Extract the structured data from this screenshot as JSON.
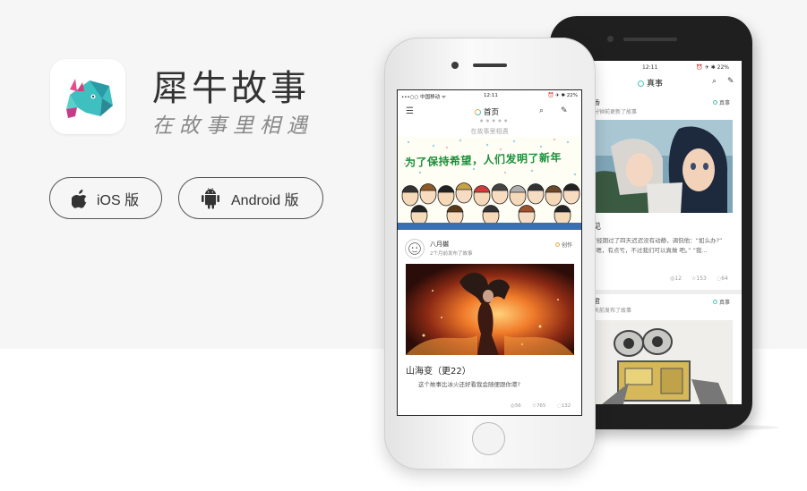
{
  "brand": {
    "title": "犀牛故事",
    "slogan": "在故事里相遇",
    "icon": "rhino-logo"
  },
  "downloads": {
    "ios_label": "iOS 版",
    "android_label": "Android 版",
    "ios_icon": "apple-icon",
    "android_icon": "android-icon"
  },
  "colors": {
    "background": "#f6f6f6",
    "accent_teal": "#4cc3b5",
    "accent_orange": "#f0a84a"
  },
  "iphone": {
    "status": {
      "carrier": "•••○○ 中国移动 ᯤ",
      "time": "12:11",
      "battery": "⏰ ✈ ✱ 22%"
    },
    "nav": {
      "title": "首页",
      "menu_icon": "menu-icon",
      "search_icon": "search-icon",
      "edit_icon": "edit-icon"
    },
    "subtitle": "在故事里相遇",
    "banner_text": "为了保持希望，人们发明了新年",
    "card": {
      "author": "八月樾",
      "meta": "2个月前发布了故事",
      "tag": "创作",
      "title": "山海变（更22）",
      "excerpt": "这个故事比冰火还好看我会随便跟你港?",
      "stats": {
        "views": "56",
        "likes": "765",
        "comments": "132"
      }
    }
  },
  "android": {
    "status": {
      "time": "12:11",
      "battery": "⏰ ✈ ✱ 22%"
    },
    "nav": {
      "title": "真事"
    },
    "card1": {
      "author": "香",
      "meta": "分钟前更新了故事",
      "tag": "真事",
      "title": "见",
      "excerpt": "7经期过了四天迟迟没有动静，调侃他：“如么办?” “嗯，有点亏，不过我们可以真做 吧。” “我...",
      "stats": {
        "views": "12",
        "likes": "153",
        "comments": "64"
      }
    },
    "card2": {
      "author": "君",
      "meta": "天前发布了故事",
      "tag": "真事"
    }
  }
}
